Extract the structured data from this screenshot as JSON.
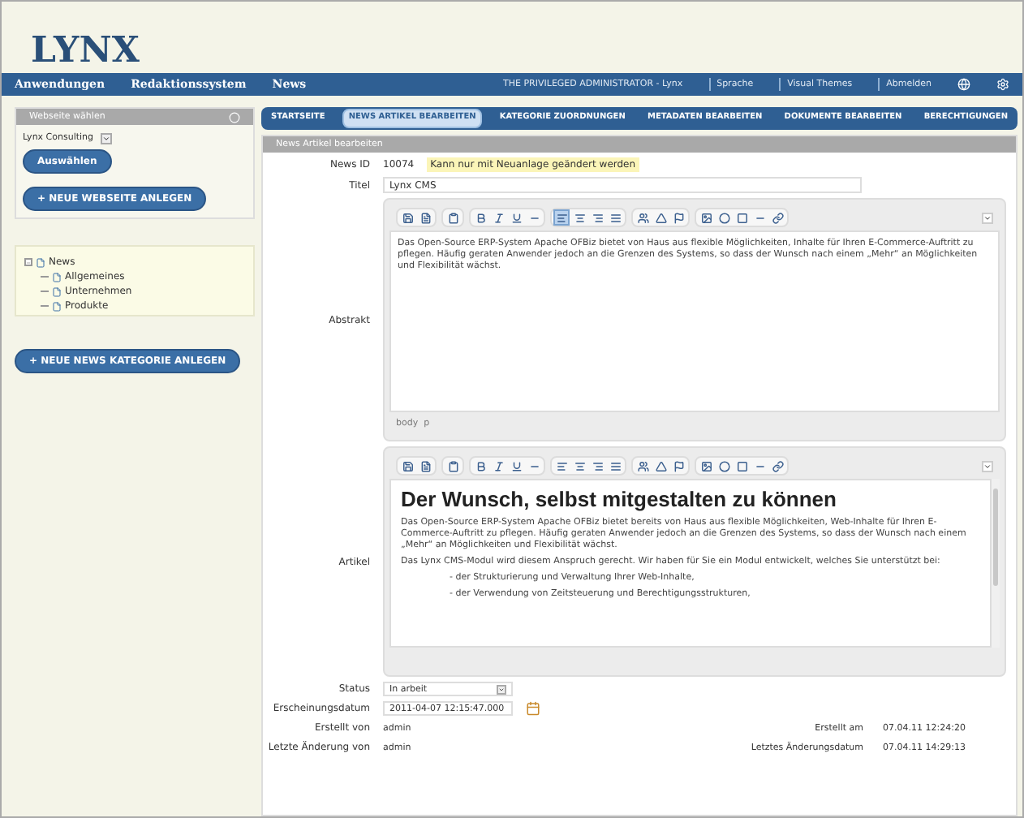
{
  "logo": {
    "text": "LYNX"
  },
  "nav": {
    "items": [
      "Anwendungen",
      "Redaktionssystem",
      "News"
    ],
    "user": "THE PRIVILEGED ADMINISTRATOR - Lynx",
    "links": [
      "Sprache",
      "Visual Themes",
      "Abmelden"
    ]
  },
  "sidebar": {
    "title": "Webseite wählen",
    "site_select": "Lynx Consulting",
    "select_button": "Auswählen",
    "new_site_button": "+ NEUE WEBSEITE ANLEGEN",
    "tree": [
      {
        "label": "News",
        "expanded": true,
        "children": [
          {
            "label": "Allgemeines"
          },
          {
            "label": "Unternehmen"
          },
          {
            "label": "Produkte"
          }
        ]
      }
    ],
    "new_category_button": "+ NEUE NEWS KATEGORIE ANLEGEN"
  },
  "tabs": [
    {
      "label": "STARTSEITE",
      "selected": false
    },
    {
      "label": "NEWS ARTIKEL BEARBEITEN",
      "selected": true
    },
    {
      "label": "KATEGORIE ZUORDNUNGEN",
      "selected": false
    },
    {
      "label": "METADATEN BEARBEITEN",
      "selected": false
    },
    {
      "label": "DOKUMENTE BEARBEITEN",
      "selected": false
    },
    {
      "label": "BERECHTIGUNGEN",
      "selected": false
    }
  ],
  "panel": {
    "title": "News Artikel bearbeiten",
    "news_id": {
      "label": "News ID",
      "value": "10074",
      "note": "Kann nur mit Neuanlage geändert werden"
    },
    "title_field": {
      "label": "Titel",
      "value": "Lynx CMS"
    },
    "abstract": {
      "label": "Abstrakt",
      "align_left_active": true,
      "paragraphs": [
        "Das Open-Source ERP-System Apache OFBiz bietet von Haus aus flexible Möglichkeiten, Inhalte für Ihren E-Commerce-Auftritt zu pflegen. Häufig geraten Anwender jedoch an die Grenzen des Systems, so dass der Wunsch nach einem „Mehr“ an Möglichkeiten und Flexibilität wächst."
      ],
      "path": "body  p"
    },
    "article": {
      "label": "Artikel",
      "align_left_active": false,
      "heading": "Der Wunsch, selbst mitgestalten zu können",
      "paragraphs": [
        "Das Open-Source ERP-System Apache OFBiz bietet bereits von Haus aus flexible Möglichkeiten, Web-Inhalte für Ihren E-Commerce-Auftritt zu pflegen. Häufig geraten Anwender jedoch an die Grenzen des Systems, so dass der Wunsch nach einem „Mehr“ an Möglichkeiten und Flexibilität wächst.",
        "Das Lynx CMS-Modul wird diesem Anspruch gerecht. Wir haben für Sie ein Modul entwickelt, welches Sie unterstützt bei:"
      ],
      "bullets": [
        "- der Strukturierung und Verwaltung Ihrer Web-Inhalte,",
        "- der Verwendung von Zeitsteuerung und Berechtigungsstrukturen,"
      ]
    },
    "status": {
      "label": "Status",
      "value": "In arbeit"
    },
    "date": {
      "label": "Erscheinungsdatum",
      "value": "2011-04-07 12:15:47.000"
    },
    "meta": [
      {
        "label": "Erstellt von",
        "value": "admin",
        "label_2": "Erstellt am",
        "value_2": "07.04.11 12:24:20"
      },
      {
        "label": "Letzte Änderung von",
        "value": "admin",
        "label_2": "Letztes Änderungsdatum",
        "value_2": "07.04.11 14:29:13"
      }
    ]
  }
}
